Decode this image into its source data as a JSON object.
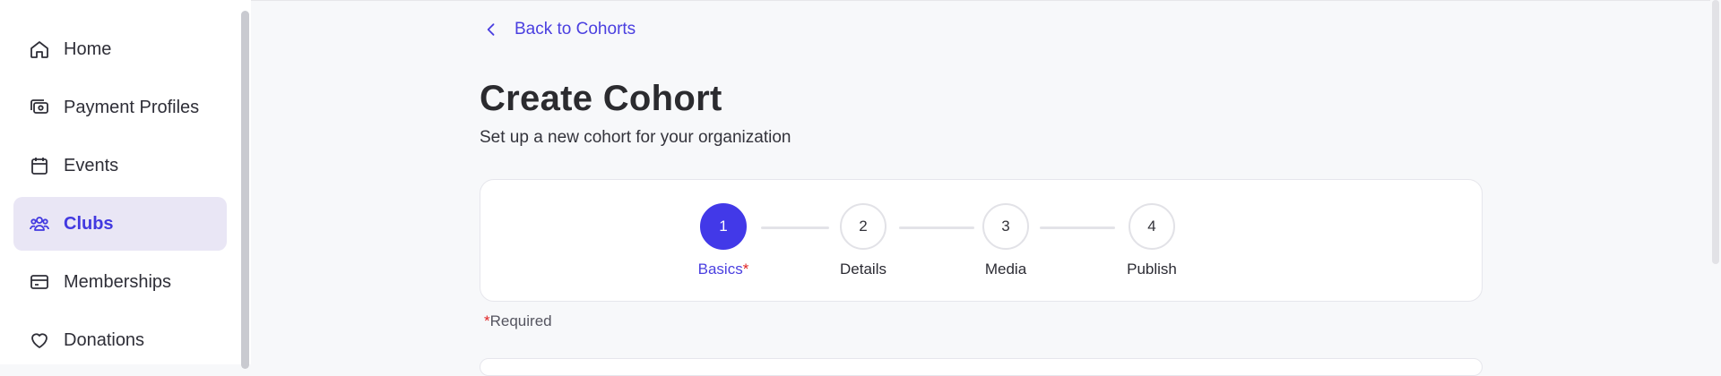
{
  "sidebar": {
    "items": [
      {
        "label": "Home",
        "icon": "home-icon",
        "active": false
      },
      {
        "label": "Payment Profiles",
        "icon": "payment-profiles-icon",
        "active": false
      },
      {
        "label": "Events",
        "icon": "calendar-icon",
        "active": false
      },
      {
        "label": "Clubs",
        "icon": "users-group-icon",
        "active": true
      },
      {
        "label": "Memberships",
        "icon": "card-icon",
        "active": false
      },
      {
        "label": "Donations",
        "icon": "heart-icon",
        "active": false
      }
    ]
  },
  "header": {
    "back_label": "Back to Cohorts",
    "title": "Create Cohort",
    "subtitle": "Set up a new cohort for your organization"
  },
  "stepper": {
    "steps": [
      {
        "number": "1",
        "label": "Basics",
        "required_mark": "*",
        "active": true
      },
      {
        "number": "2",
        "label": "Details",
        "active": false
      },
      {
        "number": "3",
        "label": "Media",
        "active": false
      },
      {
        "number": "4",
        "label": "Publish",
        "active": false
      }
    ]
  },
  "required_note": {
    "star": "*",
    "text": "Required"
  },
  "colors": {
    "accent": "#4239e8",
    "active_bg": "#e9e6f5",
    "required": "#e02424",
    "page_bg": "#f7f8fa"
  }
}
